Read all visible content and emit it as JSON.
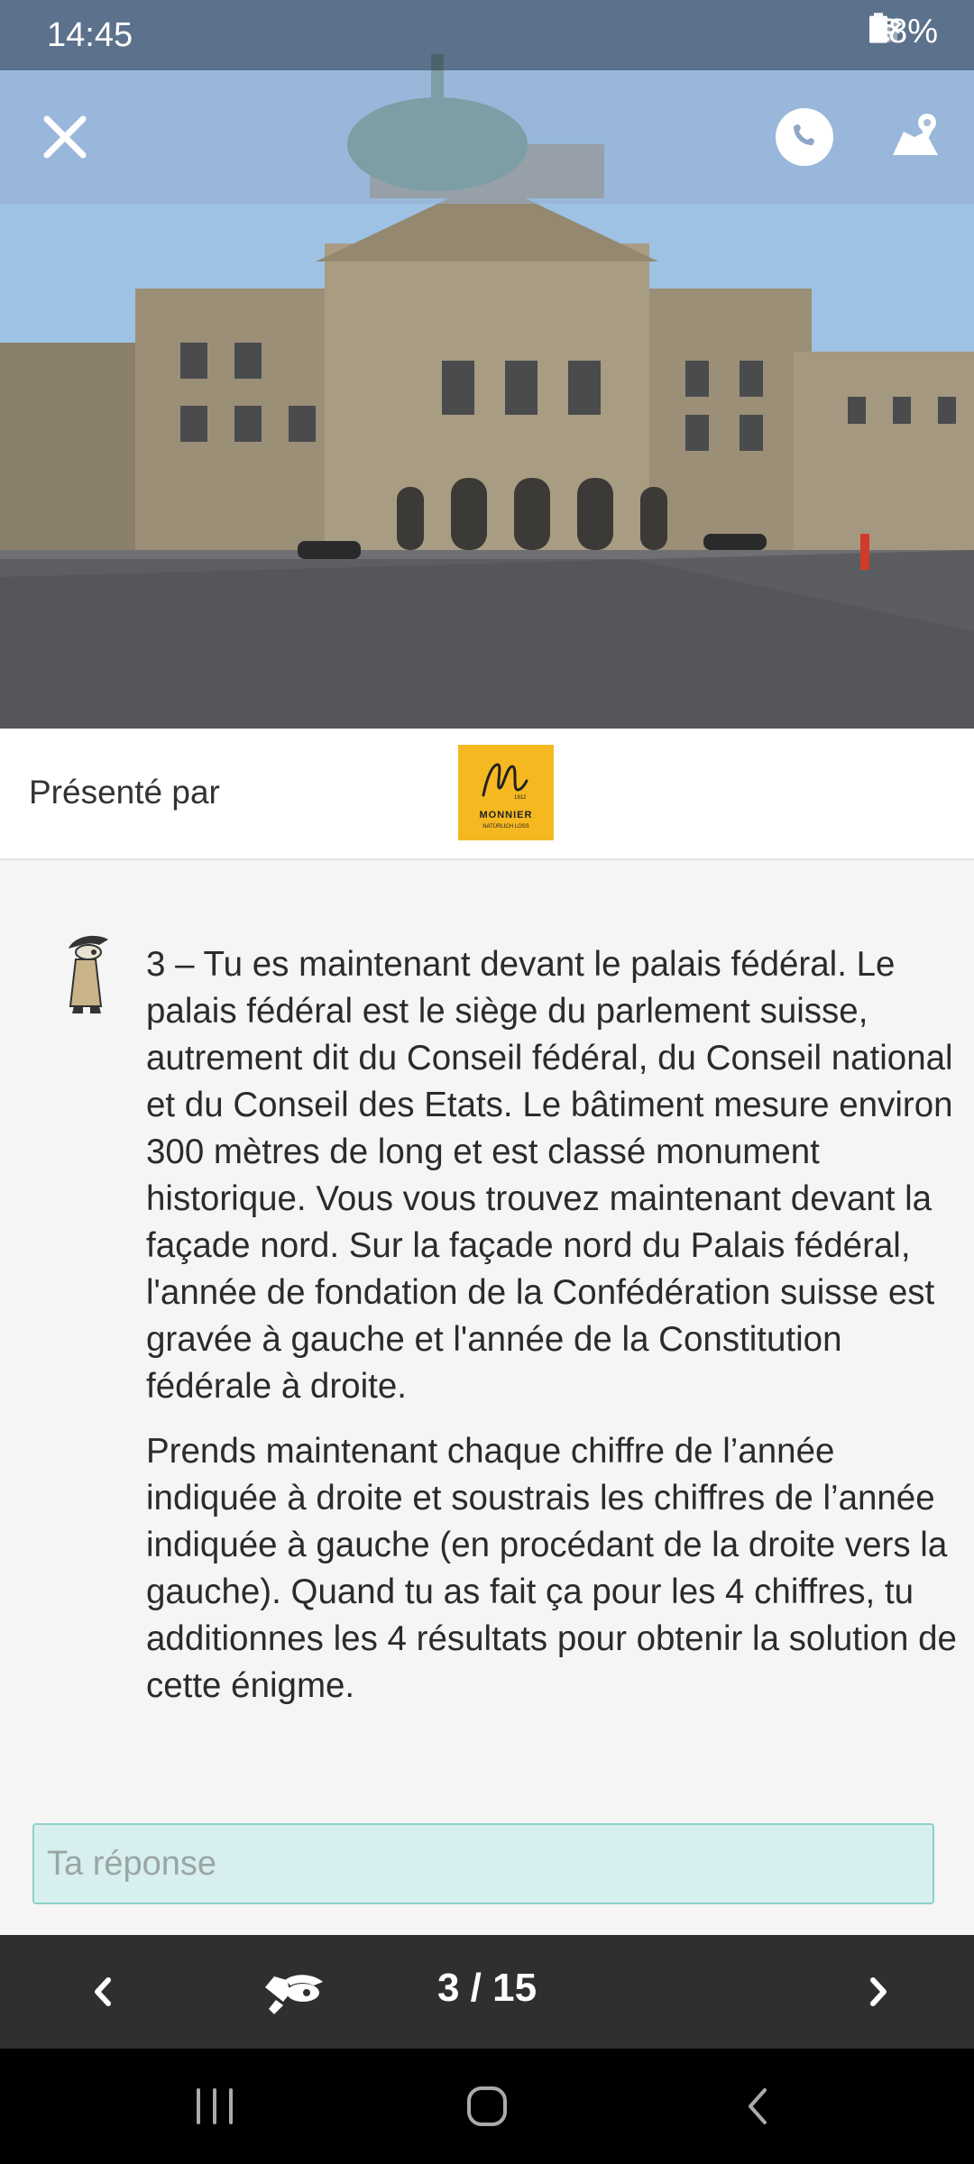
{
  "status_bar": {
    "time": "14:45",
    "battery": "68%",
    "icons": [
      "mute-icon",
      "wifi-icon",
      "signal-icon",
      "battery-icon"
    ]
  },
  "header": {
    "close_icon": "close-icon",
    "phone_icon": "phone-icon",
    "map_icon": "map-pin-icon"
  },
  "sponsor": {
    "label": "Présenté par",
    "logo_text": "MONNIER",
    "logo_subtext": "NATÜRLICH LOSS",
    "logo_year": "1912",
    "logo_color": "#f5b820"
  },
  "riddle": {
    "paragraphs": [
      "3 – Tu es maintenant devant le palais fédéral. Le palais fédéral est le siège du parlement suisse, autrement dit du Conseil fédéral, du Conseil national et du Conseil des Etats. Le bâtiment mesure environ 300 mètres de long et est classé monument historique. Vous vous trouvez maintenant devant la façade nord. Sur la façade nord du Palais fédéral, l'année de fondation de la Confédération suisse est gravée à gauche et l'année de la Constitution fédérale à droite.",
      "Prends maintenant chaque chiffre de l’année indiquée à droite et soustrais les chiffres de l’année indiquée à gauche (en procédant de la droite vers la gauche). Quand tu as fait ça pour les 4 chiffres, tu additionnes les 4 résultats pour obtenir la solution de cette énigme."
    ]
  },
  "answer": {
    "placeholder": "Ta réponse",
    "value": ""
  },
  "bottom_nav": {
    "progress": "3 / 15",
    "prev_icon": "chevron-left-icon",
    "hint_icon": "detective-hint-icon",
    "next_icon": "chevron-right-icon"
  },
  "system_nav": {
    "recent_icon": "recent-apps-icon",
    "home_icon": "home-icon",
    "back_icon": "back-icon"
  },
  "colors": {
    "bottom_nav_bg": "#2f2f2f",
    "answer_bg": "#d8efef",
    "answer_border": "#8fd0cc"
  }
}
